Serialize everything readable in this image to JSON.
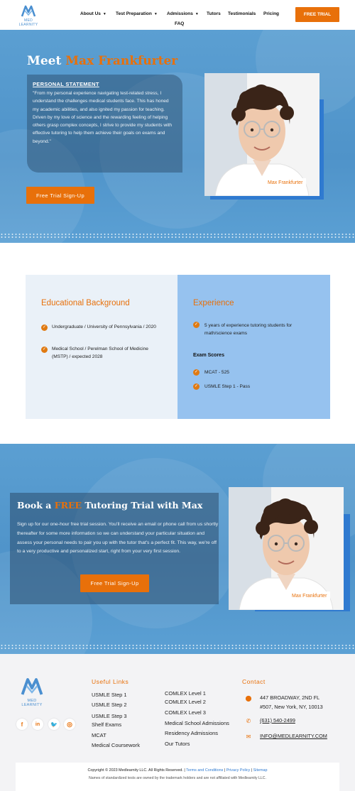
{
  "header": {
    "logo_text": "MED LEARNITY",
    "nav": [
      {
        "label": "About Us",
        "caret": true
      },
      {
        "label": "Test Preparation",
        "caret": true
      },
      {
        "label": "Admissions",
        "caret": true
      },
      {
        "label": "Tutors",
        "caret": false
      },
      {
        "label": "Testimonials",
        "caret": false
      },
      {
        "label": "Pricing",
        "caret": false
      },
      {
        "label": "FAQ",
        "caret": false
      }
    ],
    "cta_label": "FREE TRIAL"
  },
  "hero": {
    "title_prefix": "Meet ",
    "title_name": "Max Frankfurter",
    "statement_heading": "PERSONAL STATEMENT",
    "statement_text": "\"From my personal experience navigating test-related stress, I understand the challenges medical students face. This has honed my academic abilities, and also ignited my passion for teaching. Driven by my love of science and the rewarding feeling of helping others grasp complex concepts, I strive to provide my students with effective tutoring to help them achieve their goals on exams and beyond.\"",
    "button_label": "Free Trial Sign-Up",
    "photo_name_tag": "Max Frankfurter"
  },
  "education": {
    "heading": "Educational Background",
    "items": [
      "Undergraduate / University of Pennsylvania / 2020",
      "Medical School / Perelman School of Medicine (MSTP) / expected 2028"
    ]
  },
  "experience": {
    "heading": "Experience",
    "items": [
      "5 years of experience tutoring students for math/science exams"
    ],
    "scores_heading": "Exam Scores",
    "scores": [
      "MCAT - 525",
      "USMLE Step 1 - Pass"
    ]
  },
  "trial": {
    "title_prefix": "Book a ",
    "title_accent": "FREE",
    "title_suffix": " Tutoring Trial with Max",
    "text": "Sign up for our one-hour free trial session. You'll receive an email or phone call from us shortly thereafter for some more information so we can understand your particular situation and assess your personal needs to pair you up with the tutor that's a perfect fit. This way, we're off to a very productive and personalized start, right from your very first session.",
    "button_label": "Free Trial Sign-Up",
    "photo_name_tag": "Max Frankfurter"
  },
  "footer": {
    "logo_text": "MED LEARNITY",
    "social_icons": [
      "facebook-icon",
      "linkedin-icon",
      "twitter-icon",
      "instagram-icon"
    ],
    "useful_links_heading": "Useful Links",
    "links_col1": [
      "USMLE Step 1",
      "USMLE Step 2",
      "USMLE Step 3",
      "Shelf Exams",
      "MCAT",
      "Medical Coursework"
    ],
    "links_col2": [
      "COMLEX Level 1",
      "COMLEX Level 2",
      "COMLEX Level 3",
      "Medical School Admissions",
      "Residency Admissions",
      "Our Tutors"
    ],
    "contact_heading": "Contact",
    "address_line1": "447 BROADWAY, 2ND FL",
    "address_line2": "#507, New York, NY, 10013",
    "phone": "(631) 540-2499",
    "email": "INFO@MEDLEARNITY.COM",
    "copyright": "Copyright © 2023 Medlearnity LLC. All Rights Reserved.",
    "terms_link": "Terms and Conditions",
    "privacy_link": "Privacy Policy",
    "sitemap_link": "Sitemap",
    "disclaimer": "Names of standardized tests are owned by the trademark holders and are not affiliated with Medlearnity LLC."
  },
  "colors": {
    "accent": "#e8700a",
    "brand_blue": "#4f93c9",
    "light_blue_panel": "#96c2ef",
    "pale_panel": "#eaf1f8"
  }
}
